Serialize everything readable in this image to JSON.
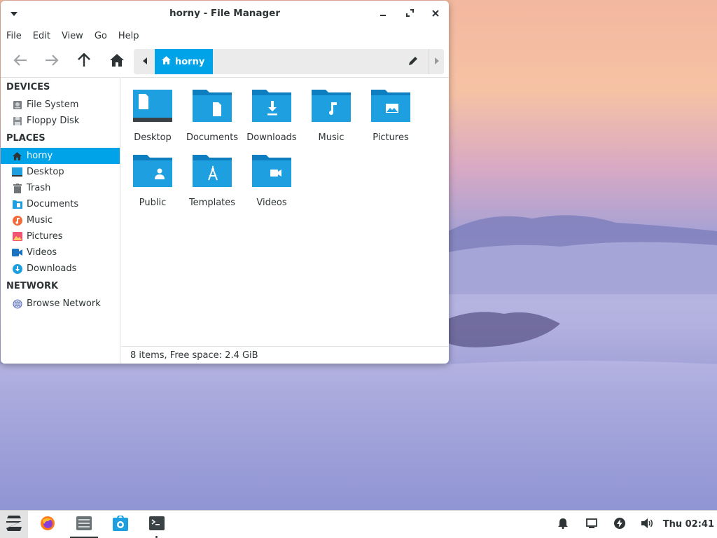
{
  "window": {
    "title": "horny - File Manager"
  },
  "menubar": [
    "File",
    "Edit",
    "View",
    "Go",
    "Help"
  ],
  "pathbar": {
    "current": "horny"
  },
  "sidebar": {
    "devices_heading": "DEVICES",
    "devices": [
      {
        "label": "File System",
        "icon": "drive-icon"
      },
      {
        "label": "Floppy Disk",
        "icon": "floppy-icon"
      }
    ],
    "places_heading": "PLACES",
    "places": [
      {
        "label": "horny",
        "icon": "home-icon",
        "active": true
      },
      {
        "label": "Desktop",
        "icon": "desktop-icon"
      },
      {
        "label": "Trash",
        "icon": "trash-icon"
      },
      {
        "label": "Documents",
        "icon": "documents-icon"
      },
      {
        "label": "Music",
        "icon": "music-icon"
      },
      {
        "label": "Pictures",
        "icon": "pictures-icon"
      },
      {
        "label": "Videos",
        "icon": "videos-icon"
      },
      {
        "label": "Downloads",
        "icon": "downloads-icon"
      }
    ],
    "network_heading": "NETWORK",
    "network": [
      {
        "label": "Browse Network",
        "icon": "network-icon"
      }
    ]
  },
  "files": [
    {
      "label": "Desktop",
      "icon": "desktop-folder-icon"
    },
    {
      "label": "Documents",
      "icon": "documents-folder-icon"
    },
    {
      "label": "Downloads",
      "icon": "downloads-folder-icon"
    },
    {
      "label": "Music",
      "icon": "music-folder-icon"
    },
    {
      "label": "Pictures",
      "icon": "pictures-folder-icon"
    },
    {
      "label": "Public",
      "icon": "public-folder-icon"
    },
    {
      "label": "Templates",
      "icon": "templates-folder-icon"
    },
    {
      "label": "Videos",
      "icon": "videos-folder-icon"
    }
  ],
  "statusbar": {
    "text": "8 items, Free space: 2.4 GiB"
  },
  "taskbar": {
    "clock": "Thu 02:41"
  },
  "colors": {
    "accent": "#00a2e8",
    "folder": "#1d9fe0",
    "folder_tab": "#0d7fc0"
  }
}
